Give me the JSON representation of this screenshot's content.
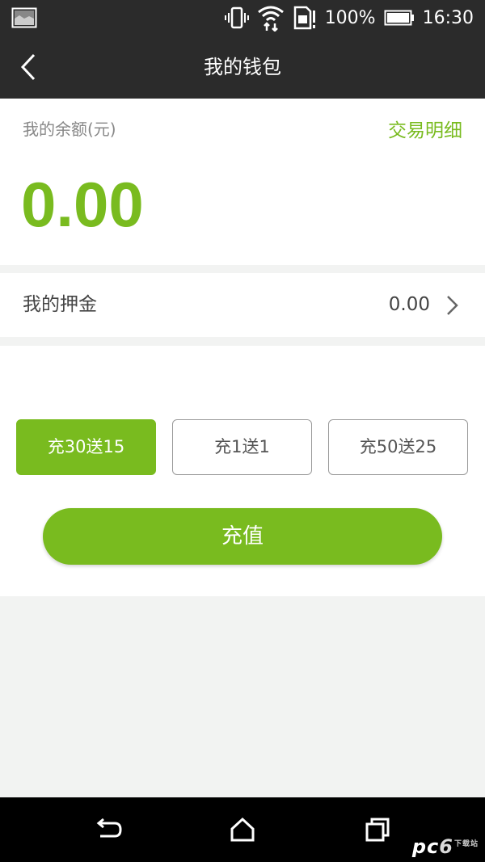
{
  "status_bar": {
    "battery": "100%",
    "time": "16:30"
  },
  "header": {
    "title": "我的钱包"
  },
  "balance": {
    "label": "我的余额(元)",
    "amount": "0.00",
    "transactions_link": "交易明细"
  },
  "deposit": {
    "label": "我的押金",
    "value": "0.00"
  },
  "recharge": {
    "options": [
      {
        "label": "充30送15",
        "selected": true
      },
      {
        "label": "充1送1",
        "selected": false
      },
      {
        "label": "充50送25",
        "selected": false
      }
    ],
    "button_label": "充值"
  },
  "watermark": {
    "text_a": "pc",
    "text_b": "6",
    "text_sub": "下载站"
  },
  "colors": {
    "accent": "#79bb1f",
    "header_bg": "#2b2b2b",
    "page_bg": "#f2f3f2"
  },
  "icons": [
    "gallery-icon",
    "vibrate-icon",
    "wifi-icon",
    "sim-icon",
    "battery-icon",
    "back-icon",
    "chevron-right-icon",
    "nav-back-icon",
    "nav-home-icon",
    "nav-recents-icon"
  ]
}
